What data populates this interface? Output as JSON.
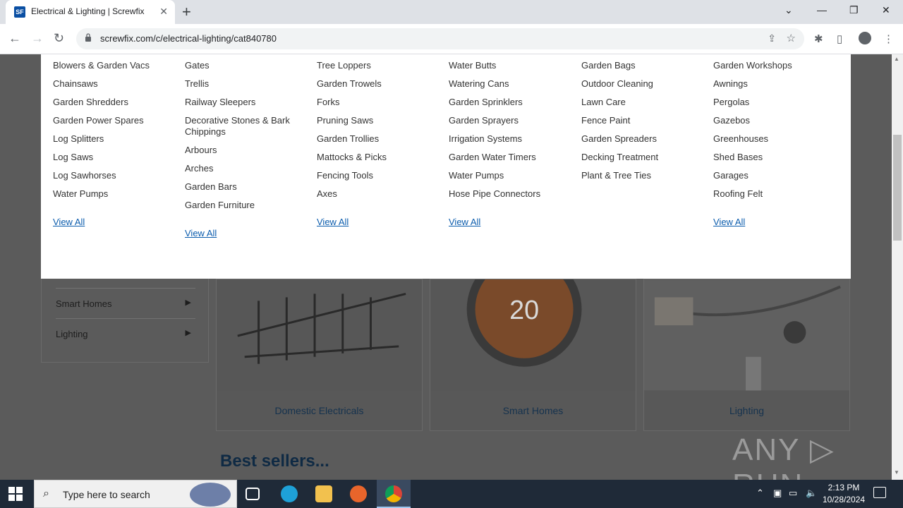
{
  "browser": {
    "tab_title": "Electrical & Lighting | Screwfix",
    "favicon_text": "SF",
    "url": "screwfix.com/c/electrical-lighting/cat840780",
    "new_tab": "+",
    "tab_close": "✕",
    "controls": {
      "minimize": "—",
      "restore": "❐",
      "close": "✕",
      "tablist": "⌄"
    }
  },
  "megamenu": {
    "columns": [
      {
        "items": [
          "Blowers & Garden Vacs",
          "Chainsaws",
          "Garden Shredders",
          "Garden Power Spares",
          "Log Splitters",
          "Log Saws",
          "Log Sawhorses",
          "Water Pumps"
        ],
        "view_all": "View All"
      },
      {
        "items": [
          "Gates",
          "Trellis",
          "Railway Sleepers",
          "Decorative Stones & Bark Chippings",
          "Arbours",
          "Arches",
          "Garden Bars",
          "Garden Furniture"
        ],
        "view_all": "View All"
      },
      {
        "items": [
          "Tree Loppers",
          "Garden Trowels",
          "Forks",
          "Pruning Saws",
          "Garden Trollies",
          "Mattocks & Picks",
          "Fencing Tools",
          "Axes"
        ],
        "view_all": "View All"
      },
      {
        "items": [
          "Water Butts",
          "Watering Cans",
          "Garden Sprinklers",
          "Garden Sprayers",
          "Irrigation Systems",
          "Garden Water Timers",
          "Water Pumps",
          "Hose Pipe Connectors"
        ],
        "view_all": "View All"
      },
      {
        "items": [
          "Garden Bags",
          "Outdoor Cleaning",
          "Lawn Care",
          "Fence Paint",
          "Garden Spreaders",
          "Decking Treatment",
          "Plant & Tree Ties"
        ],
        "view_all": ""
      },
      {
        "items": [
          "Garden Workshops",
          "Awnings",
          "Pergolas",
          "Gazebos",
          "Greenhouses",
          "Shed Bases",
          "Garages",
          "Roofing Felt"
        ],
        "view_all": "View All"
      }
    ]
  },
  "sidebar": {
    "items": [
      {
        "label": "Smart Homes",
        "arrow": "▶"
      },
      {
        "label": "Lighting",
        "arrow": "▶"
      }
    ]
  },
  "cards": [
    {
      "label": "Domestic Electricals"
    },
    {
      "label": "Smart Homes",
      "display_value": "20"
    },
    {
      "label": "Lighting"
    }
  ],
  "best_sellers": "Best sellers...",
  "watermark": "ANY ▷ RUN",
  "taskbar": {
    "search_placeholder": "Type here to search",
    "time": "2:13 PM",
    "date": "10/28/2024"
  }
}
